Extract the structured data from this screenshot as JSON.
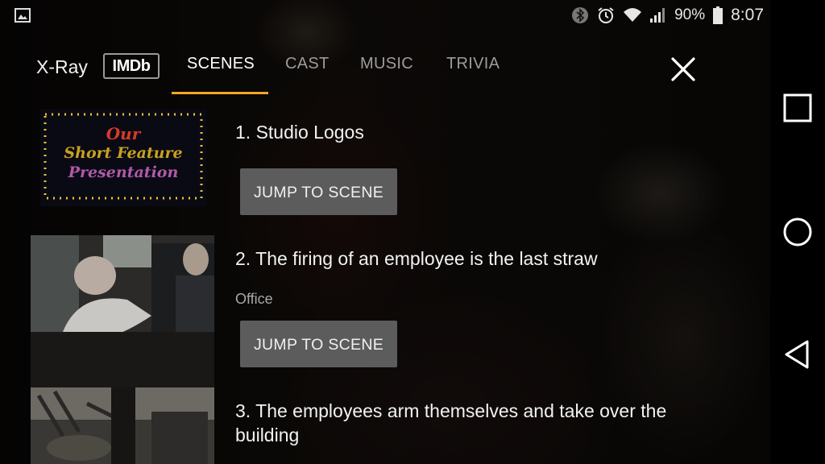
{
  "status_bar": {
    "battery": "90%",
    "time": "8:07"
  },
  "header": {
    "title": "X-Ray",
    "logo_text": "IMDb",
    "tabs": [
      {
        "label": "SCENES",
        "active": true
      },
      {
        "label": "CAST",
        "active": false
      },
      {
        "label": "MUSIC",
        "active": false
      },
      {
        "label": "TRIVIA",
        "active": false
      }
    ]
  },
  "scenes": [
    {
      "title": "1. Studio Logos",
      "subtitle": "",
      "thumbnail_text": [
        "Our",
        "Short Feature",
        "Presentation"
      ],
      "button_label": "JUMP TO SCENE"
    },
    {
      "title": "2. The firing of an employee is the last straw",
      "subtitle": "Office",
      "button_label": "JUMP TO SCENE"
    },
    {
      "title_line1": "3. The employees arm themselves and take over the",
      "title_line2": "building"
    }
  ],
  "colors": {
    "accent": "#f5a623",
    "button_bg": "#5c5c5c",
    "tab_inactive": "#9c9c9c"
  },
  "icons": [
    "image-icon",
    "bluetooth-icon",
    "alarm-icon",
    "wifi-icon",
    "signal-icon",
    "battery-icon",
    "close-icon",
    "recents-icon",
    "home-icon",
    "back-icon"
  ]
}
